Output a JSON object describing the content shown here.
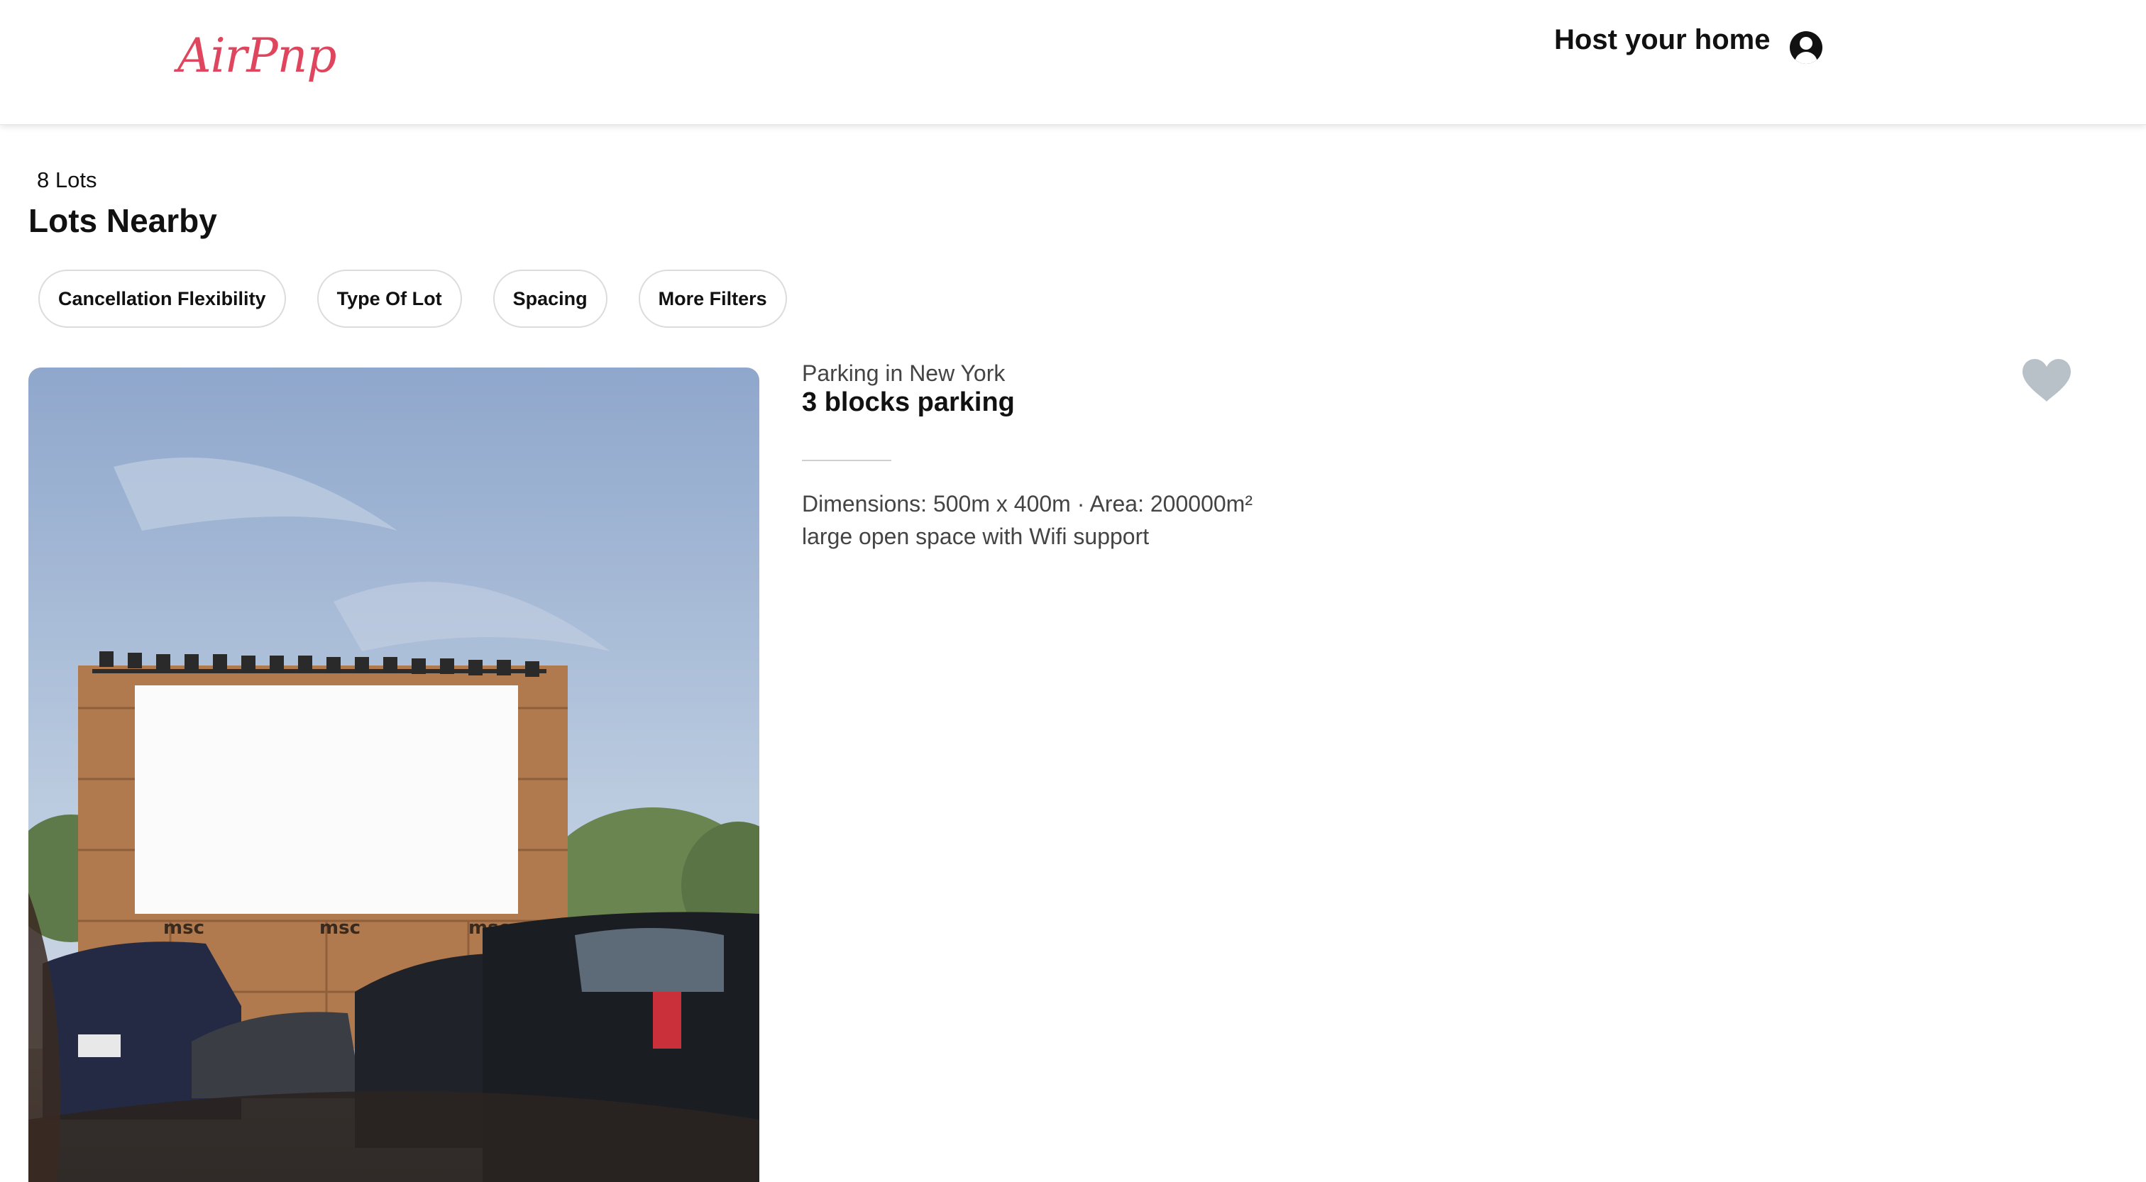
{
  "header": {
    "logo": "AirPnp",
    "host_label": "Host your home",
    "avatar_icon": "user-avatar-icon",
    "brand_color": "#e0455e"
  },
  "results": {
    "count_label": "8 Lots",
    "heading": "Lots Nearby"
  },
  "filters": [
    {
      "label": "Cancellation Flexibility"
    },
    {
      "label": "Type Of Lot"
    },
    {
      "label": "Spacing"
    },
    {
      "label": "More Filters"
    }
  ],
  "listing": {
    "location": "Parking in New York",
    "name": "3 blocks parking",
    "dimensions": "Dimensions: 500m x 400m · Area: 200000m²",
    "description": "large open space with Wifi support",
    "favorite_icon": "heart-icon",
    "favorite_color": "#b8c0c8",
    "photo_icon": "drive-in-parking-photo"
  }
}
